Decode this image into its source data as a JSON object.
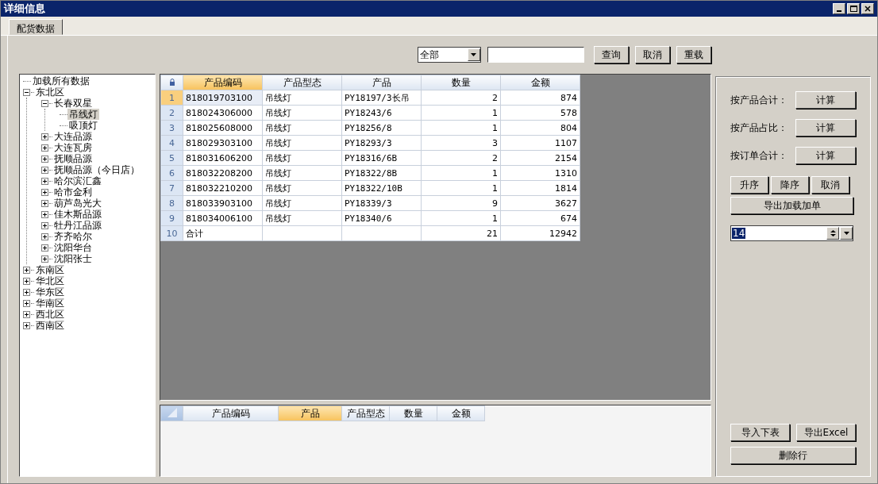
{
  "window": {
    "title": "详细信息"
  },
  "tabs": [
    {
      "label": "配货数据",
      "selected": true
    }
  ],
  "filter": {
    "dropdown": "全部",
    "buttons": [
      "查询",
      "取消",
      "重载"
    ]
  },
  "tree": [
    {
      "label": "加载所有数据",
      "kind": "leaf",
      "selected": false
    },
    {
      "label": "东北区",
      "kind": "folder",
      "expanded": true,
      "selected": false,
      "children": [
        {
          "label": "长春双星",
          "kind": "folder",
          "expanded": true,
          "selected": false,
          "children": [
            {
              "label": "吊线灯",
              "kind": "leaf",
              "selected": true
            },
            {
              "label": "吸顶灯",
              "kind": "leaf",
              "selected": false
            }
          ]
        },
        {
          "label": "大连品源",
          "kind": "folder",
          "expanded": false,
          "selected": false
        },
        {
          "label": "大连瓦房",
          "kind": "folder",
          "expanded": false,
          "selected": false
        },
        {
          "label": "抚顺品源",
          "kind": "folder",
          "expanded": false,
          "selected": false
        },
        {
          "label": "抚顺品源（今日店）",
          "kind": "folder",
          "expanded": false,
          "selected": false
        },
        {
          "label": "哈尔滨汇鑫",
          "kind": "folder",
          "expanded": false,
          "selected": false
        },
        {
          "label": "哈市金利",
          "kind": "folder",
          "expanded": false,
          "selected": false
        },
        {
          "label": "葫芦岛光大",
          "kind": "folder",
          "expanded": false,
          "selected": false
        },
        {
          "label": "佳木斯品源",
          "kind": "folder",
          "expanded": false,
          "selected": false
        },
        {
          "label": "牡丹江品源",
          "kind": "folder",
          "expanded": false,
          "selected": false
        },
        {
          "label": "齐齐哈尔",
          "kind": "folder",
          "expanded": false,
          "selected": false
        },
        {
          "label": "沈阳华台",
          "kind": "folder",
          "expanded": false,
          "selected": false
        },
        {
          "label": "沈阳张士",
          "kind": "folder",
          "expanded": false,
          "selected": false
        }
      ]
    },
    {
      "label": "东南区",
      "kind": "folder",
      "expanded": false,
      "selected": false
    },
    {
      "label": "华北区",
      "kind": "folder",
      "expanded": false,
      "selected": false
    },
    {
      "label": "华东区",
      "kind": "folder",
      "expanded": false,
      "selected": false
    },
    {
      "label": "华南区",
      "kind": "folder",
      "expanded": false,
      "selected": false
    },
    {
      "label": "西北区",
      "kind": "folder",
      "expanded": false,
      "selected": false
    },
    {
      "label": "西南区",
      "kind": "folder",
      "expanded": false,
      "selected": false
    }
  ],
  "grid": {
    "columns": [
      {
        "label": "产品编码",
        "kind": "text",
        "selected": true
      },
      {
        "label": "产品型态",
        "kind": "text",
        "selected": false
      },
      {
        "label": "产品",
        "kind": "mono",
        "selected": false
      },
      {
        "label": "数量",
        "kind": "number",
        "selected": false
      },
      {
        "label": "金额",
        "kind": "number",
        "selected": false
      }
    ],
    "rows": [
      {
        "number": "1",
        "selected": true,
        "cells": [
          "818019703100",
          "吊线灯",
          "PY18197/3长吊",
          "2",
          "874"
        ]
      },
      {
        "number": "2",
        "selected": false,
        "cells": [
          "818024306000",
          "吊线灯",
          "PY18243/6",
          "1",
          "578"
        ]
      },
      {
        "number": "3",
        "selected": false,
        "cells": [
          "818025608000",
          "吊线灯",
          "PY18256/8",
          "1",
          "804"
        ]
      },
      {
        "number": "4",
        "selected": false,
        "cells": [
          "818029303100",
          "吊线灯",
          "PY18293/3",
          "3",
          "1107"
        ]
      },
      {
        "number": "5",
        "selected": false,
        "cells": [
          "818031606200",
          "吊线灯",
          "PY18316/6B",
          "2",
          "2154"
        ]
      },
      {
        "number": "6",
        "selected": false,
        "cells": [
          "818032208200",
          "吊线灯",
          "PY18322/8B",
          "1",
          "1310"
        ]
      },
      {
        "number": "7",
        "selected": false,
        "cells": [
          "818032210200",
          "吊线灯",
          "PY18322/10B",
          "1",
          "1814"
        ]
      },
      {
        "number": "8",
        "selected": false,
        "cells": [
          "818033903100",
          "吊线灯",
          "PY18339/3",
          "9",
          "3627"
        ]
      },
      {
        "number": "9",
        "selected": false,
        "cells": [
          "818034006100",
          "吊线灯",
          "PY18340/6",
          "1",
          "674"
        ]
      },
      {
        "number": "10",
        "selected": false,
        "cells": [
          "合计",
          "",
          "",
          "21",
          "12942"
        ]
      }
    ]
  },
  "lower_grid": {
    "columns": [
      {
        "label": "产品编码",
        "selected": false
      },
      {
        "label": "产品",
        "selected": true
      },
      {
        "label": "产品型态",
        "selected": false
      },
      {
        "label": "数量",
        "selected": false
      },
      {
        "label": "金额",
        "selected": false
      }
    ]
  },
  "side_panel": {
    "calc_rows": [
      {
        "label": "按产品合计：",
        "button": "计算"
      },
      {
        "label": "按产品占比：",
        "button": "计算"
      },
      {
        "label": "按订单合计：",
        "button": "计算"
      }
    ],
    "sort_buttons": [
      "升序",
      "降序",
      "取消"
    ],
    "export_button": "导出加载加单",
    "spinner": {
      "value": "14",
      "text_selected": true
    },
    "bottom_buttons": [
      [
        "导入下表",
        "导出Excel"
      ],
      [
        "删除行"
      ]
    ]
  }
}
